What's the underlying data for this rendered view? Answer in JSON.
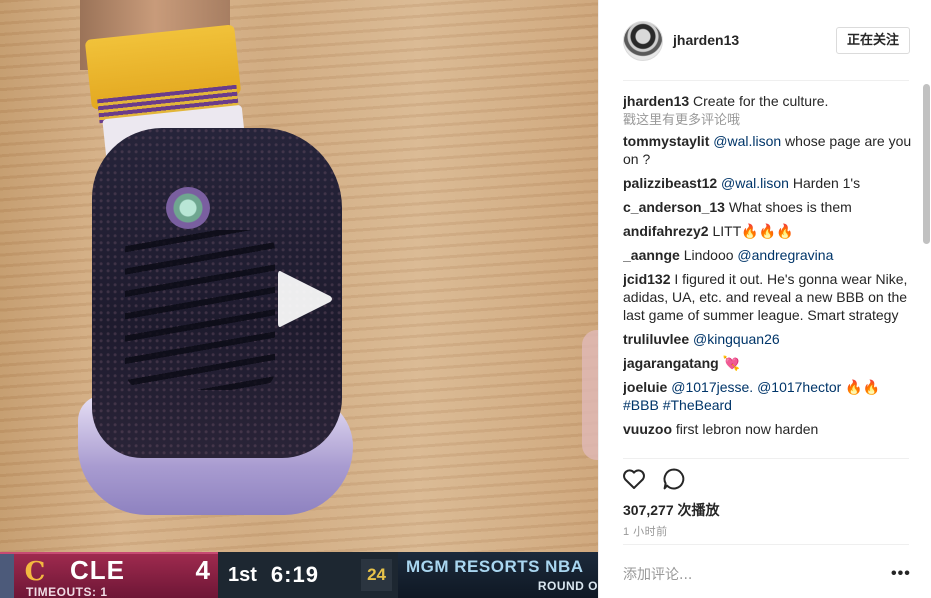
{
  "post": {
    "author": "jharden13",
    "follow_label": "正在关注",
    "view_more_comments": "戳这里有更多评论哦",
    "comments": [
      {
        "user": "jharden13",
        "mention": "",
        "text": "Create for the culture."
      },
      {
        "user": "tommystaylit",
        "mention": "@wal.lison",
        "text": "whose page are you on ?"
      },
      {
        "user": "palizzibeast12",
        "mention": "@wal.lison",
        "text": "Harden 1's"
      },
      {
        "user": "c_anderson_13",
        "mention": "",
        "text": "What shoes is them"
      },
      {
        "user": "andifahrezy2",
        "mention": "",
        "text": "LITT🔥🔥🔥"
      },
      {
        "user": "_aannge",
        "mention": "",
        "text": "Lindooo",
        "mention_after": "@andregravina"
      },
      {
        "user": "jcid132",
        "mention": "",
        "text": "I figured it out. He's gonna wear Nike, adidas, UA, etc. and reveal a new BBB on the last game of summer league. Smart strategy"
      },
      {
        "user": "truliluvlee",
        "mention": "@kingquan26",
        "text": ""
      },
      {
        "user": "jagarangatang",
        "mention": "",
        "text": "💘"
      },
      {
        "user": "joeluie",
        "mention": "@1017jesse. @1017hector",
        "text": "🔥🔥",
        "mention_after": "#BBB #TheBeard"
      },
      {
        "user": "vuuzoo",
        "mention": "",
        "text": "first lebron now harden"
      }
    ],
    "views": "307,277 次播放",
    "time_ago": "1 小时前",
    "add_comment_placeholder": "添加评论...",
    "options_label": "•••"
  },
  "icons": {
    "like": "heart-outline-icon",
    "comment": "speech-bubble-icon",
    "play": "play-icon"
  },
  "scoreboard": {
    "team": "CLE",
    "score": "4",
    "timeouts": "TIMEOUTS: 1",
    "period": "1st",
    "clock": "6:19",
    "shot_clock": "24",
    "brand": "MGM RESORTS NBA",
    "round": "ROUND O",
    "team_color": "#8a2046",
    "logo_glyph": "C"
  }
}
